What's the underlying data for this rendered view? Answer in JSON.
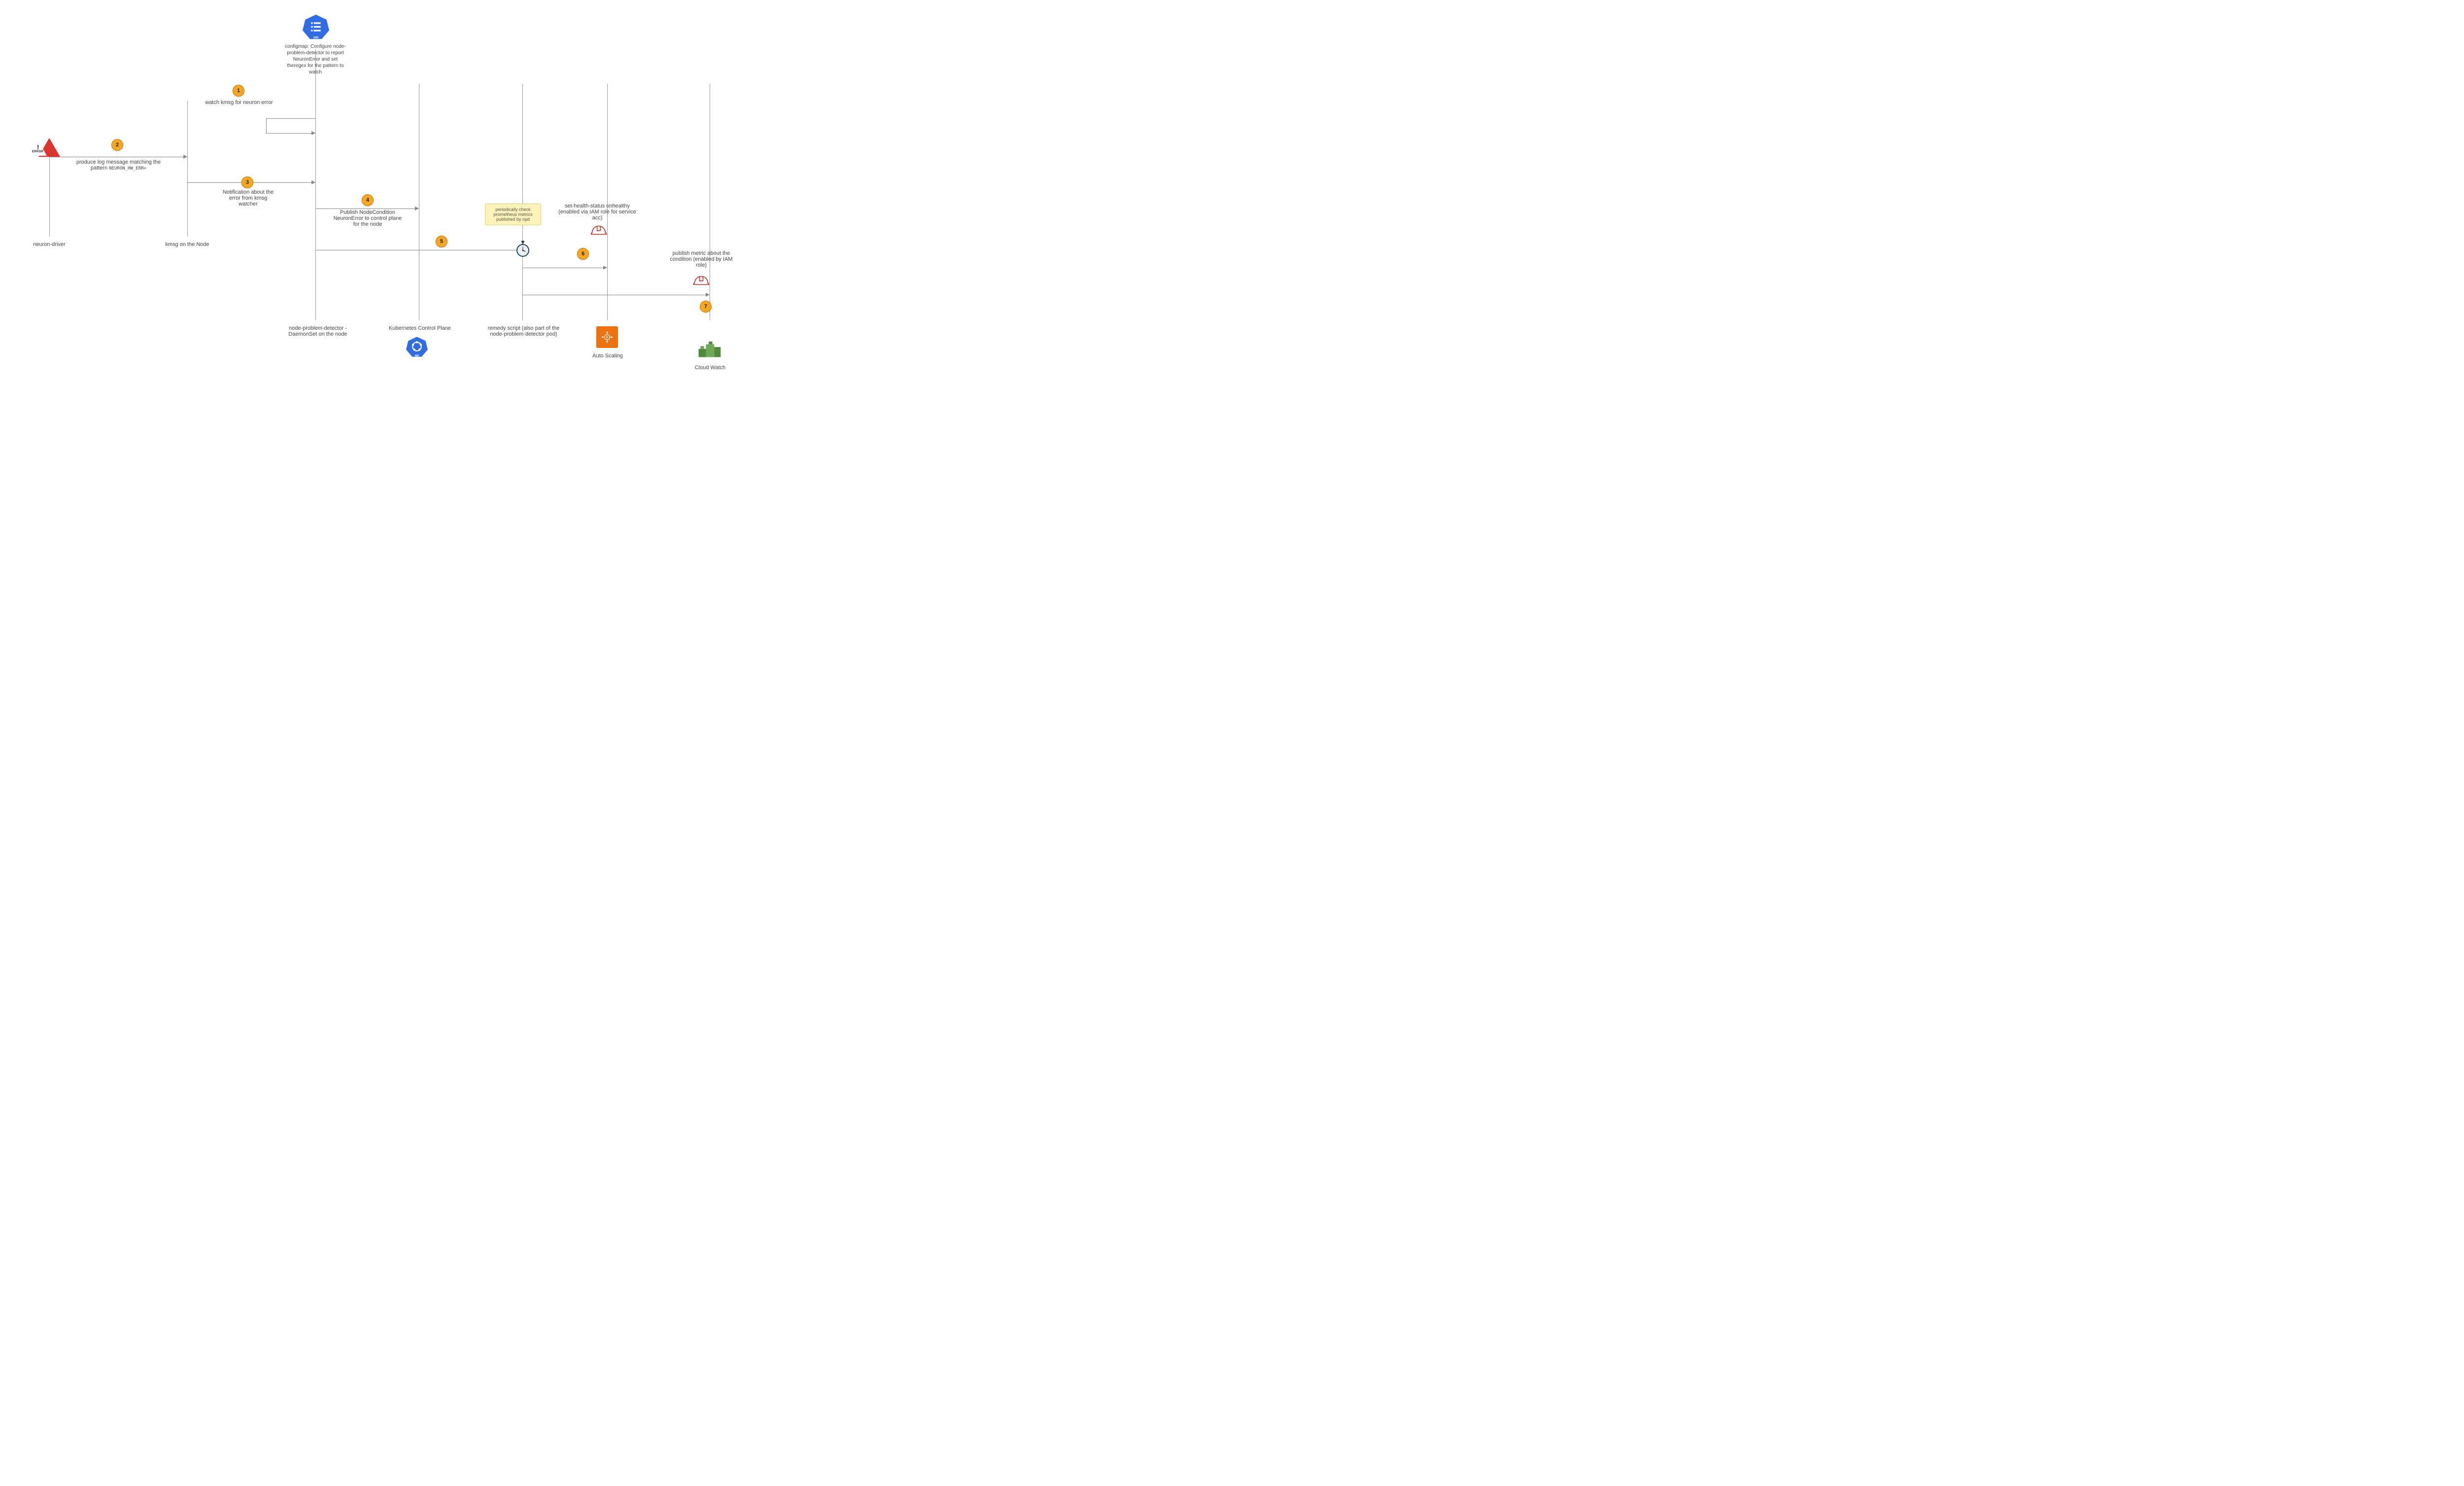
{
  "lifelines": {
    "neuron_driver": "neuron-driver",
    "kmsg": "kmsg on the Node",
    "npd": "node-problem-detector -DaemonSet on the node",
    "kcp": "Kubernetes Control Plane",
    "remedy": "remedy script (also part of the node-problem-detector pod)",
    "asg": "Auto Scaling",
    "cw": "Cloud Watch"
  },
  "configmap_text": "configmap: Configure node-problem-detector to report NeuronError and set theregex for the pattern to watch",
  "configmap_badge": "cm",
  "note_text": "periodically check prometheus metrics published by npd",
  "error_label": "ERROR",
  "steps": {
    "s1": {
      "num": "1",
      "label": "watch kmsg for neuron error"
    },
    "s2": {
      "num": "2",
      "label": "produce log message matching the pattern",
      "pattern": "NEURON_HW_ERR="
    },
    "s3": {
      "num": "3",
      "label": "Notification about the error from kmsg watcher"
    },
    "s4": {
      "num": "4",
      "label": "Publish NodeCondition NeuronError to control plane for the node"
    },
    "s5": {
      "num": "5",
      "label": ""
    },
    "s6": {
      "num": "6",
      "label": "set-health-status unhealthy (enabled via IAM role for service acc)"
    },
    "s7": {
      "num": "7",
      "label": "publish metric about the condition (enabled by IAM role)"
    }
  },
  "icons": {
    "api_badge": "api"
  }
}
